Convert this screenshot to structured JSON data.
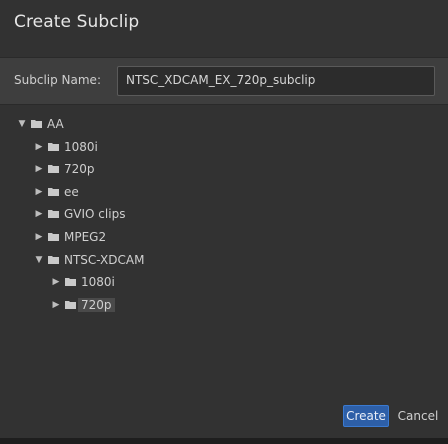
{
  "dialog": {
    "title": "Create Subclip"
  },
  "subclip": {
    "label": "Subclip Name:",
    "value": "NTSC_XDCAM_EX_720p_subclip"
  },
  "tree": [
    {
      "label": "AA",
      "level": 0,
      "expanded": true
    },
    {
      "label": "1080i",
      "level": 1,
      "expanded": false
    },
    {
      "label": "720p",
      "level": 1,
      "expanded": false
    },
    {
      "label": "ee",
      "level": 1,
      "expanded": false
    },
    {
      "label": "GVIO clips",
      "level": 1,
      "expanded": false
    },
    {
      "label": "MPEG2",
      "level": 1,
      "expanded": false
    },
    {
      "label": "NTSC-XDCAM",
      "level": 1,
      "expanded": true
    },
    {
      "label": "1080i",
      "level": 2,
      "expanded": false
    },
    {
      "label": "720p",
      "level": 2,
      "expanded": false,
      "selected": true
    }
  ],
  "buttons": {
    "create": "Create",
    "cancel": "Cancel"
  },
  "colors": {
    "folder": "#c9c9c9",
    "accent": "#2d5fa8"
  }
}
